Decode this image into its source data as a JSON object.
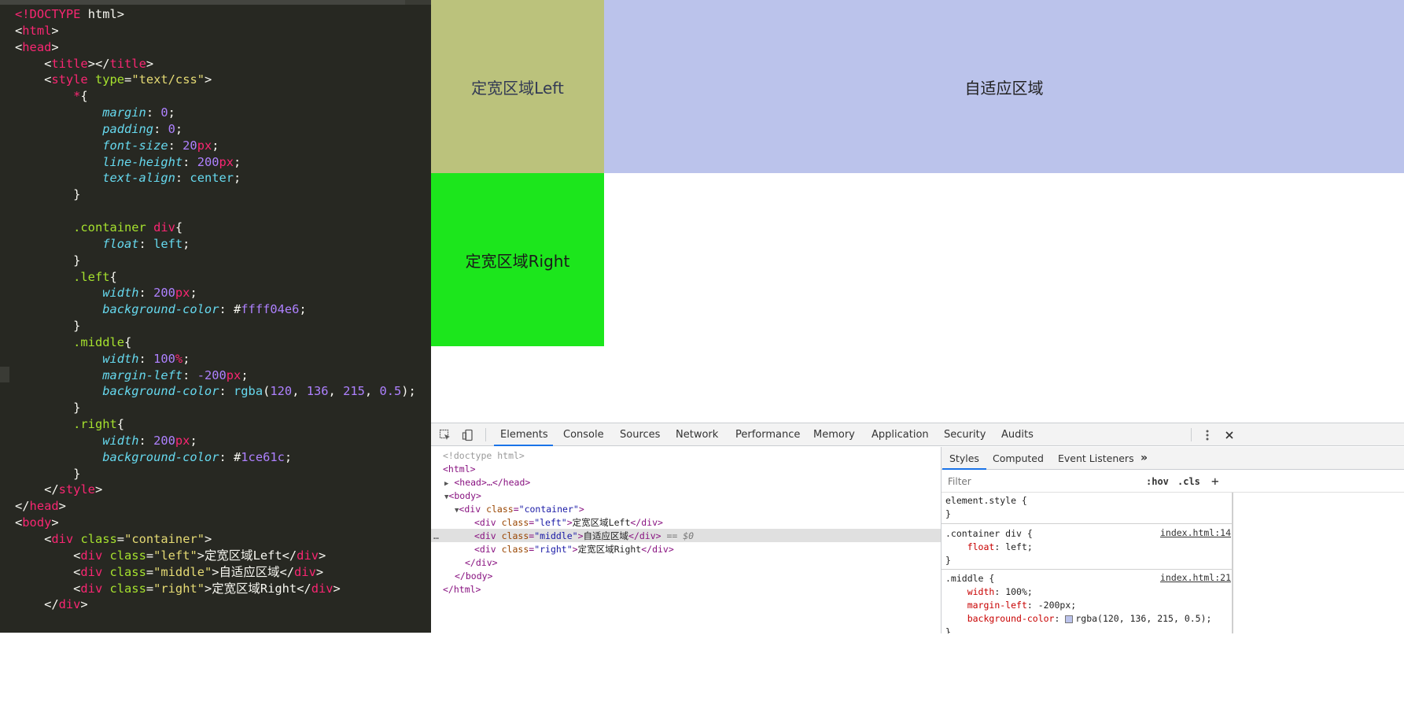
{
  "editor": {
    "lines": [
      [
        [
          "tg",
          "<!"
        ],
        [
          "tg",
          "DOCTYPE"
        ],
        [
          "pl",
          " html>"
        ]
      ],
      [
        [
          "pl",
          "<"
        ],
        [
          "tg",
          "html"
        ],
        [
          "pl",
          ">"
        ]
      ],
      [
        [
          "pl",
          "<"
        ],
        [
          "tg",
          "head"
        ],
        [
          "pl",
          ">"
        ]
      ],
      [
        [
          "pl",
          "    <"
        ],
        [
          "tg",
          "title"
        ],
        [
          "pl",
          "></"
        ],
        [
          "tg",
          "title"
        ],
        [
          "pl",
          ">"
        ]
      ],
      [
        [
          "pl",
          "    <"
        ],
        [
          "tg",
          "style"
        ],
        [
          "pl",
          " "
        ],
        [
          "at",
          "type"
        ],
        [
          "pl",
          "="
        ],
        [
          "st",
          "\"text/css\""
        ],
        [
          "pl",
          ">"
        ]
      ],
      [
        [
          "pl",
          "        "
        ],
        [
          "tg",
          "*"
        ],
        [
          "pl",
          "{"
        ]
      ],
      [
        [
          "pl",
          "            "
        ],
        [
          "pr",
          "margin"
        ],
        [
          "pl",
          ": "
        ],
        [
          "nm",
          "0"
        ],
        [
          "pl",
          ";"
        ]
      ],
      [
        [
          "pl",
          "            "
        ],
        [
          "pr",
          "padding"
        ],
        [
          "pl",
          ": "
        ],
        [
          "nm",
          "0"
        ],
        [
          "pl",
          ";"
        ]
      ],
      [
        [
          "pl",
          "            "
        ],
        [
          "pr",
          "font-size"
        ],
        [
          "pl",
          ": "
        ],
        [
          "nm",
          "20"
        ],
        [
          "un",
          "px"
        ],
        [
          "pl",
          ";"
        ]
      ],
      [
        [
          "pl",
          "            "
        ],
        [
          "pr",
          "line-height"
        ],
        [
          "pl",
          ": "
        ],
        [
          "nm",
          "200"
        ],
        [
          "un",
          "px"
        ],
        [
          "pl",
          ";"
        ]
      ],
      [
        [
          "pl",
          "            "
        ],
        [
          "pr",
          "text-align"
        ],
        [
          "pl",
          ": "
        ],
        [
          "vl",
          "center"
        ],
        [
          "pl",
          ";"
        ]
      ],
      [
        [
          "pl",
          "        }"
        ]
      ],
      [
        [
          "pl",
          ""
        ]
      ],
      [
        [
          "pl",
          "        "
        ],
        [
          "sl",
          ".container"
        ],
        [
          "pl",
          " "
        ],
        [
          "tg",
          "div"
        ],
        [
          "pl",
          "{"
        ]
      ],
      [
        [
          "pl",
          "            "
        ],
        [
          "pr",
          "float"
        ],
        [
          "pl",
          ": "
        ],
        [
          "vl",
          "left"
        ],
        [
          "pl",
          ";"
        ]
      ],
      [
        [
          "pl",
          "        }"
        ]
      ],
      [
        [
          "pl",
          "        "
        ],
        [
          "sl",
          ".left"
        ],
        [
          "pl",
          "{"
        ]
      ],
      [
        [
          "pl",
          "            "
        ],
        [
          "pr",
          "width"
        ],
        [
          "pl",
          ": "
        ],
        [
          "nm",
          "200"
        ],
        [
          "un",
          "px"
        ],
        [
          "pl",
          ";"
        ]
      ],
      [
        [
          "pl",
          "            "
        ],
        [
          "pr",
          "background-color"
        ],
        [
          "pl",
          ": #"
        ],
        [
          "hx",
          "ffff04e6"
        ],
        [
          "pl",
          ";"
        ]
      ],
      [
        [
          "pl",
          "        }"
        ]
      ],
      [
        [
          "pl",
          "        "
        ],
        [
          "sl",
          ".middle"
        ],
        [
          "pl",
          "{"
        ]
      ],
      [
        [
          "pl",
          "            "
        ],
        [
          "pr",
          "width"
        ],
        [
          "pl",
          ": "
        ],
        [
          "nm",
          "100"
        ],
        [
          "un",
          "%"
        ],
        [
          "pl",
          ";"
        ]
      ],
      [
        [
          "pl",
          "            "
        ],
        [
          "pr",
          "margin-left"
        ],
        [
          "pl",
          ": "
        ],
        [
          "nm",
          "-200"
        ],
        [
          "un",
          "px"
        ],
        [
          "pl",
          ";"
        ]
      ],
      [
        [
          "pl",
          "            "
        ],
        [
          "pr",
          "background-color"
        ],
        [
          "pl",
          ": "
        ],
        [
          "vl",
          "rgba"
        ],
        [
          "pl",
          "("
        ],
        [
          "nm",
          "120"
        ],
        [
          "pl",
          ", "
        ],
        [
          "nm",
          "136"
        ],
        [
          "pl",
          ", "
        ],
        [
          "nm",
          "215"
        ],
        [
          "pl",
          ", "
        ],
        [
          "nm",
          "0.5"
        ],
        [
          "pl",
          ");"
        ]
      ],
      [
        [
          "pl",
          "        }"
        ]
      ],
      [
        [
          "pl",
          "        "
        ],
        [
          "sl",
          ".right"
        ],
        [
          "pl",
          "{"
        ]
      ],
      [
        [
          "pl",
          "            "
        ],
        [
          "pr",
          "width"
        ],
        [
          "pl",
          ": "
        ],
        [
          "nm",
          "200"
        ],
        [
          "un",
          "px"
        ],
        [
          "pl",
          ";"
        ]
      ],
      [
        [
          "pl",
          "            "
        ],
        [
          "pr",
          "background-color"
        ],
        [
          "pl",
          ": #"
        ],
        [
          "hx",
          "1ce61c"
        ],
        [
          "pl",
          ";"
        ]
      ],
      [
        [
          "pl",
          "        }"
        ]
      ],
      [
        [
          "pl",
          "    </"
        ],
        [
          "tg",
          "style"
        ],
        [
          "pl",
          ">"
        ]
      ],
      [
        [
          "pl",
          "</"
        ],
        [
          "tg",
          "head"
        ],
        [
          "pl",
          ">"
        ]
      ],
      [
        [
          "pl",
          "<"
        ],
        [
          "tg",
          "body"
        ],
        [
          "pl",
          ">"
        ]
      ],
      [
        [
          "pl",
          "    <"
        ],
        [
          "tg",
          "div"
        ],
        [
          "pl",
          " "
        ],
        [
          "at",
          "class"
        ],
        [
          "pl",
          "="
        ],
        [
          "st",
          "\"container\""
        ],
        [
          "pl",
          ">"
        ]
      ],
      [
        [
          "pl",
          "        <"
        ],
        [
          "tg",
          "div"
        ],
        [
          "pl",
          " "
        ],
        [
          "at",
          "class"
        ],
        [
          "pl",
          "="
        ],
        [
          "st",
          "\"left\""
        ],
        [
          "pl",
          ">定宽区域Left</"
        ],
        [
          "tg",
          "div"
        ],
        [
          "pl",
          ">"
        ]
      ],
      [
        [
          "pl",
          "        <"
        ],
        [
          "tg",
          "div"
        ],
        [
          "pl",
          " "
        ],
        [
          "at",
          "class"
        ],
        [
          "pl",
          "="
        ],
        [
          "st",
          "\"middle\""
        ],
        [
          "pl",
          ">自适应区域</"
        ],
        [
          "tg",
          "div"
        ],
        [
          "pl",
          ">"
        ]
      ],
      [
        [
          "pl",
          "        <"
        ],
        [
          "tg",
          "div"
        ],
        [
          "pl",
          " "
        ],
        [
          "at",
          "class"
        ],
        [
          "pl",
          "="
        ],
        [
          "st",
          "\"right\""
        ],
        [
          "pl",
          ">定宽区域Right</"
        ],
        [
          "tg",
          "div"
        ],
        [
          "pl",
          ">"
        ]
      ],
      [
        [
          "pl",
          "    </"
        ],
        [
          "tg",
          "div"
        ],
        [
          "pl",
          ">"
        ]
      ]
    ]
  },
  "viewport": {
    "left_text": "定宽区域Left",
    "middle_text": "自适应区域",
    "right_text": "定宽区域Right",
    "colors": {
      "left": "#bbc27c",
      "middle": "#bbc3eb",
      "right": "#1ce61c"
    }
  },
  "devtools": {
    "tabs": [
      "Elements",
      "Console",
      "Sources",
      "Network",
      "Performance",
      "Memory",
      "Application",
      "Security",
      "Audits"
    ],
    "active_tab": "Elements",
    "dom": {
      "doctype": "<!doctype html>",
      "html_open": "<html>",
      "head": "<head>…</head>",
      "body_open": "<body>",
      "container_open_tag": "div",
      "container_attr": "class",
      "container_value": "\"container\"",
      "left_attr_value": "\"left\"",
      "left_text": "定宽区域Left",
      "middle_attr_value": "\"middle\"",
      "middle_text": "自适应区域",
      "selected_marker": " == $0",
      "right_attr_value": "\"right\"",
      "right_text": "定宽区域Right",
      "div_close": "</div>",
      "body_close": "</body>",
      "html_close": "</html>",
      "ellipsis": "…"
    },
    "styles": {
      "tabs": [
        "Styles",
        "Computed",
        "Event Listeners"
      ],
      "more": "»",
      "filter_placeholder": "Filter",
      "hov": ":hov",
      "cls": ".cls",
      "add": "+",
      "element_style": "element.style {",
      "close_brace": "}",
      "rule1_selector": ".container div {",
      "rule1_source": "index.html:14",
      "rule1_prop": "float",
      "rule1_val": "left;",
      "rule2_selector": ".middle {",
      "rule2_source": "index.html:21",
      "rule2_props": [
        {
          "name": "width",
          "value": "100%;"
        },
        {
          "name": "margin-left",
          "value": "-200px;"
        },
        {
          "name": "background-color",
          "value": "rgba(120, 136, 215, 0.5);"
        }
      ]
    }
  }
}
